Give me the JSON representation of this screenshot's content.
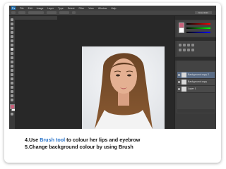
{
  "app": {
    "menu": [
      "File",
      "Edit",
      "Image",
      "Layer",
      "Type",
      "Select",
      "Filter",
      "View",
      "Window",
      "Help"
    ],
    "workspace": "Essentials"
  },
  "colors": {
    "accent": "#2a74c9",
    "background": "#2f2f2f",
    "foreground_swatch": "#c8607a",
    "background_swatch": "#ffffff"
  },
  "icons": {
    "app_logo": "photoshop-logo-icon",
    "tools": "tool-icons",
    "eye": "eye-icon"
  },
  "layers": [
    {
      "name": "Background copy 2"
    },
    {
      "name": "Background copy"
    },
    {
      "name": "Layer 1"
    }
  ],
  "caption": {
    "line1_prefix": "4.Use ",
    "line1_highlight": "Brush tool",
    "line1_suffix": " to colour her lips and eyebrow",
    "line2": "5.Change background colour by using Brush"
  }
}
